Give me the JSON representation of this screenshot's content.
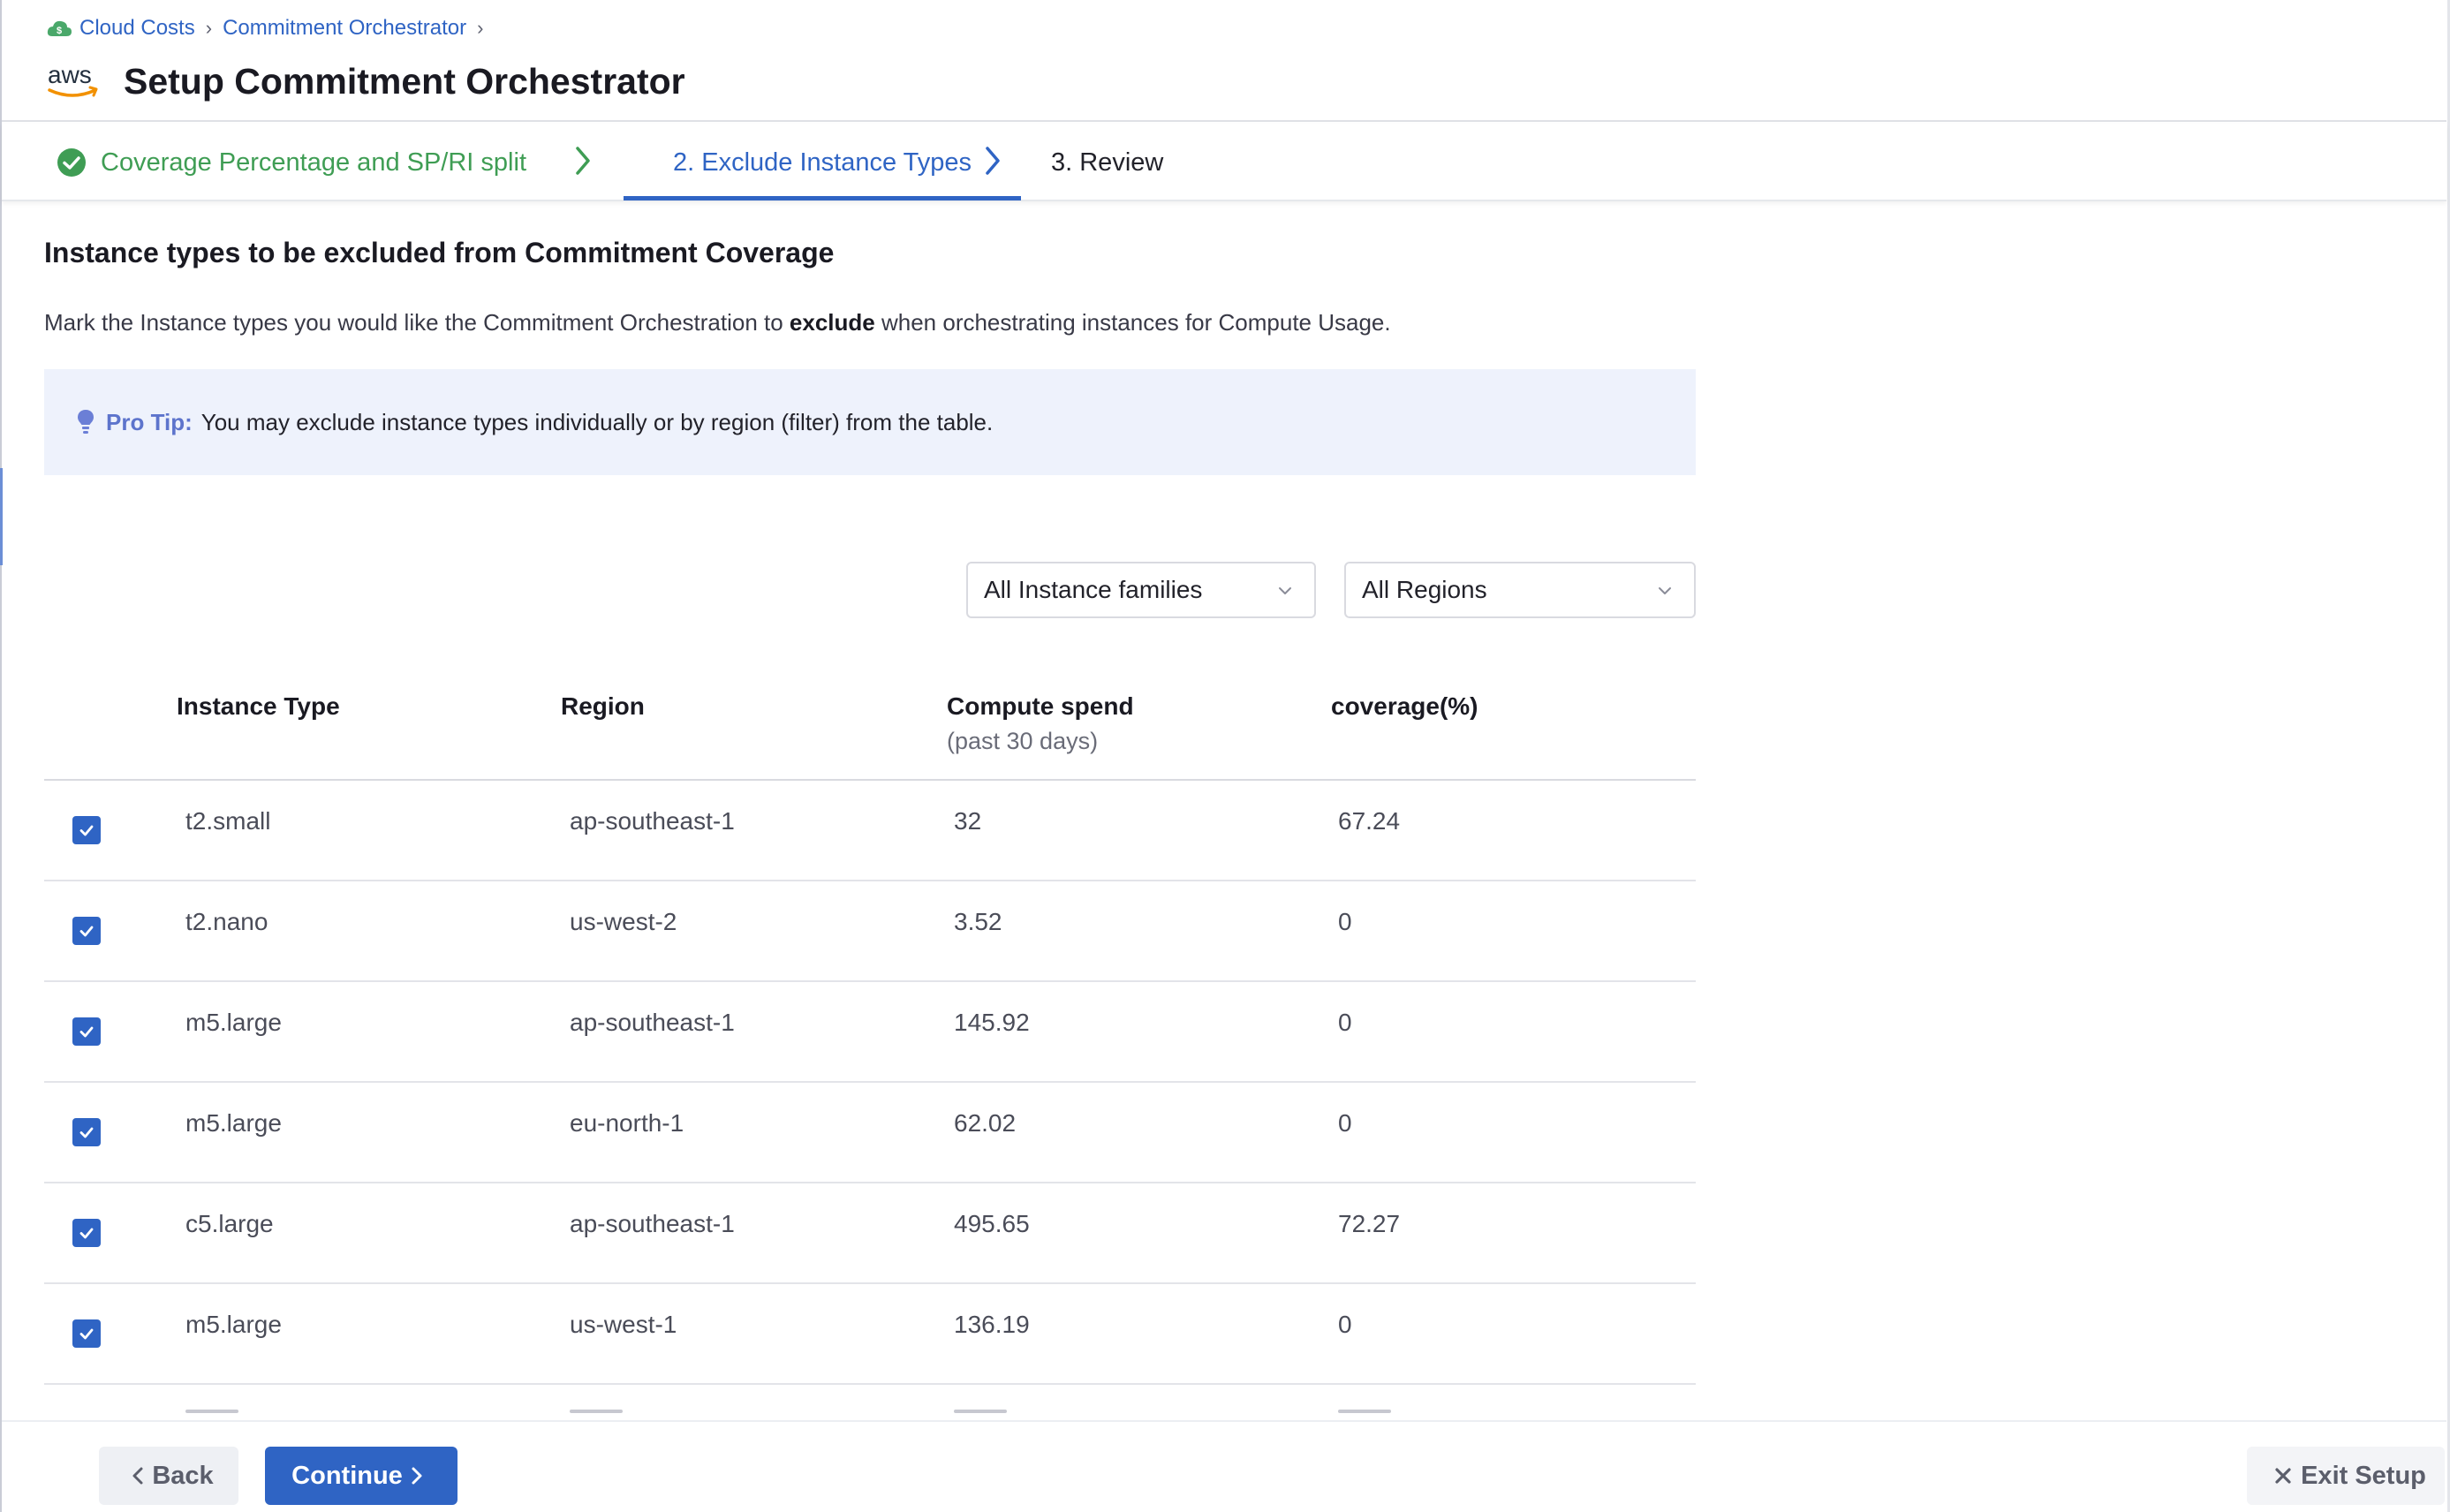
{
  "breadcrumb": {
    "items": [
      "Cloud Costs",
      "Commitment Orchestrator"
    ]
  },
  "header": {
    "logo_text": "aws",
    "title": "Setup Commitment Orchestrator"
  },
  "stepper": {
    "steps": [
      {
        "label": "Coverage Percentage and SP/RI split",
        "state": "complete"
      },
      {
        "label": "2. Exclude Instance Types",
        "state": "active"
      },
      {
        "label": "3. Review",
        "state": "pending"
      }
    ]
  },
  "section": {
    "title": "Instance types to be excluded from Commitment Coverage",
    "desc_before": "Mark the Instance types you would like the Commitment Orchestration to ",
    "desc_bold": "exclude",
    "desc_after": " when orchestrating instances for Compute Usage."
  },
  "protip": {
    "label": "Pro Tip:",
    "text": "You may exclude instance types individually or by region (filter) from the table."
  },
  "filters": {
    "families": "All Instance families",
    "regions": "All Regions"
  },
  "table": {
    "headers": {
      "type": "Instance Type",
      "region": "Region",
      "spend": "Compute spend",
      "spend_sub": "(past 30 days)",
      "coverage": "coverage(%)"
    },
    "rows": [
      {
        "type": "t2.small",
        "region": "ap-southeast-1",
        "spend": "32",
        "coverage": "67.24",
        "checked": true
      },
      {
        "type": "t2.nano",
        "region": "us-west-2",
        "spend": "3.52",
        "coverage": "0",
        "checked": true
      },
      {
        "type": "m5.large",
        "region": "ap-southeast-1",
        "spend": "145.92",
        "coverage": "0",
        "checked": true
      },
      {
        "type": "m5.large",
        "region": "eu-north-1",
        "spend": "62.02",
        "coverage": "0",
        "checked": true
      },
      {
        "type": "c5.large",
        "region": "ap-southeast-1",
        "spend": "495.65",
        "coverage": "72.27",
        "checked": true
      },
      {
        "type": "m5.large",
        "region": "us-west-1",
        "spend": "136.19",
        "coverage": "0",
        "checked": true
      }
    ]
  },
  "footer": {
    "back": "Back",
    "continue": "Continue",
    "exit": "Exit Setup"
  },
  "colors": {
    "accent": "#2f64c4",
    "success": "#3f9d54",
    "protip_bg": "#eef2fc",
    "protip_label": "#5d74cc"
  },
  "icons": {
    "breadcrumb": "cloud-costs-icon",
    "logo": "aws-logo",
    "step_complete": "check-circle-icon",
    "step_separator": "chevron-right-icon",
    "protip": "lightbulb-icon",
    "dropdown": "chevron-down-icon",
    "checkbox": "checkmark-icon",
    "back": "chevron-left-icon",
    "continue": "chevron-right-icon",
    "exit": "close-icon"
  }
}
